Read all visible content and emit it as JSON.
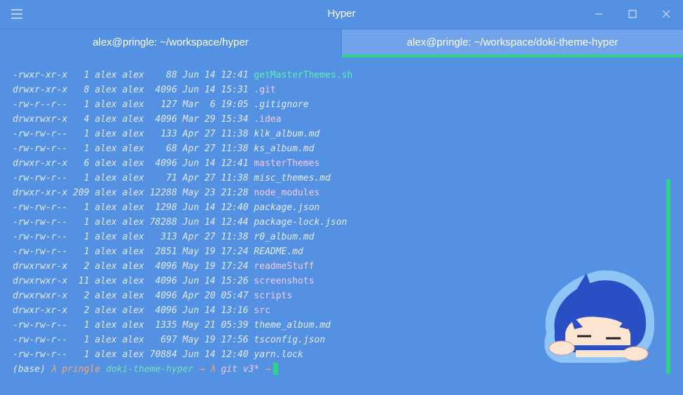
{
  "window": {
    "title": "Hyper",
    "accent": "#2ed38a",
    "background": "#5591e2"
  },
  "tabs": [
    {
      "label": "alex@pringle: ~/workspace/hyper",
      "active": false
    },
    {
      "label": "alex@pringle: ~/workspace/doki-theme-hyper",
      "active": true
    }
  ],
  "terminal": {
    "listing": [
      {
        "perm": "-rwxr-xr-x",
        "links": "  1",
        "owner": "alex",
        "group": "alex",
        "size": "   88",
        "date": "Jun 14 12:41",
        "name": "getMasterThemes.sh",
        "kind": "exec"
      },
      {
        "perm": "drwxr-xr-x",
        "links": "  8",
        "owner": "alex",
        "group": "alex",
        "size": " 4096",
        "date": "Jun 14 15:31",
        "name": ".git",
        "kind": "dir"
      },
      {
        "perm": "-rw-r--r--",
        "links": "  1",
        "owner": "alex",
        "group": "alex",
        "size": "  127",
        "date": "Mar  6 19:05",
        "name": ".gitignore",
        "kind": "file"
      },
      {
        "perm": "drwxrwxr-x",
        "links": "  4",
        "owner": "alex",
        "group": "alex",
        "size": " 4096",
        "date": "Mar 29 15:34",
        "name": ".idea",
        "kind": "dir"
      },
      {
        "perm": "-rw-rw-r--",
        "links": "  1",
        "owner": "alex",
        "group": "alex",
        "size": "  133",
        "date": "Apr 27 11:38",
        "name": "klk_album.md",
        "kind": "file"
      },
      {
        "perm": "-rw-rw-r--",
        "links": "  1",
        "owner": "alex",
        "group": "alex",
        "size": "   68",
        "date": "Apr 27 11:38",
        "name": "ks_album.md",
        "kind": "file"
      },
      {
        "perm": "drwxr-xr-x",
        "links": "  6",
        "owner": "alex",
        "group": "alex",
        "size": " 4096",
        "date": "Jun 14 12:41",
        "name": "masterThemes",
        "kind": "dir"
      },
      {
        "perm": "-rw-rw-r--",
        "links": "  1",
        "owner": "alex",
        "group": "alex",
        "size": "   71",
        "date": "Apr 27 11:38",
        "name": "misc_themes.md",
        "kind": "file"
      },
      {
        "perm": "drwxr-xr-x",
        "links": "209",
        "owner": "alex",
        "group": "alex",
        "size": "12288",
        "date": "May 23 21:28",
        "name": "node_modules",
        "kind": "dir"
      },
      {
        "perm": "-rw-rw-r--",
        "links": "  1",
        "owner": "alex",
        "group": "alex",
        "size": " 1298",
        "date": "Jun 14 12:40",
        "name": "package.json",
        "kind": "file"
      },
      {
        "perm": "-rw-rw-r--",
        "links": "  1",
        "owner": "alex",
        "group": "alex",
        "size": "78288",
        "date": "Jun 14 12:44",
        "name": "package-lock.json",
        "kind": "file"
      },
      {
        "perm": "-rw-rw-r--",
        "links": "  1",
        "owner": "alex",
        "group": "alex",
        "size": "  313",
        "date": "Apr 27 11:38",
        "name": "r0_album.md",
        "kind": "file"
      },
      {
        "perm": "-rw-rw-r--",
        "links": "  1",
        "owner": "alex",
        "group": "alex",
        "size": " 2851",
        "date": "May 19 17:24",
        "name": "README.md",
        "kind": "file"
      },
      {
        "perm": "drwxrwxr-x",
        "links": "  2",
        "owner": "alex",
        "group": "alex",
        "size": " 4096",
        "date": "May 19 17:24",
        "name": "readmeStuff",
        "kind": "dir"
      },
      {
        "perm": "drwxrwxr-x",
        "links": " 11",
        "owner": "alex",
        "group": "alex",
        "size": " 4096",
        "date": "Jun 14 15:26",
        "name": "screenshots",
        "kind": "dir"
      },
      {
        "perm": "drwxrwxr-x",
        "links": "  2",
        "owner": "alex",
        "group": "alex",
        "size": " 4096",
        "date": "Apr 20 05:47",
        "name": "scripts",
        "kind": "dir"
      },
      {
        "perm": "drwxr-xr-x",
        "links": "  2",
        "owner": "alex",
        "group": "alex",
        "size": " 4096",
        "date": "Jun 14 13:16",
        "name": "src",
        "kind": "dir"
      },
      {
        "perm": "-rw-rw-r--",
        "links": "  1",
        "owner": "alex",
        "group": "alex",
        "size": " 1335",
        "date": "May 21 05:39",
        "name": "theme_album.md",
        "kind": "file"
      },
      {
        "perm": "-rw-rw-r--",
        "links": "  1",
        "owner": "alex",
        "group": "alex",
        "size": "  697",
        "date": "May 19 17:56",
        "name": "tsconfig.json",
        "kind": "file"
      },
      {
        "perm": "-rw-rw-r--",
        "links": "  1",
        "owner": "alex",
        "group": "alex",
        "size": "70884",
        "date": "Jun 14 12:40",
        "name": "yarn.lock",
        "kind": "file"
      }
    ],
    "prompt": {
      "env": "(base)",
      "lambda1": "λ",
      "host": "pringle",
      "dir": "doki-theme-hyper",
      "arrow1": "→",
      "lambda2": "λ",
      "git": "git v3*",
      "arrow2": "→"
    }
  },
  "icons": {
    "menu": "hamburger-icon",
    "minimize": "minimize-icon",
    "maximize": "maximize-icon",
    "close": "close-icon"
  }
}
